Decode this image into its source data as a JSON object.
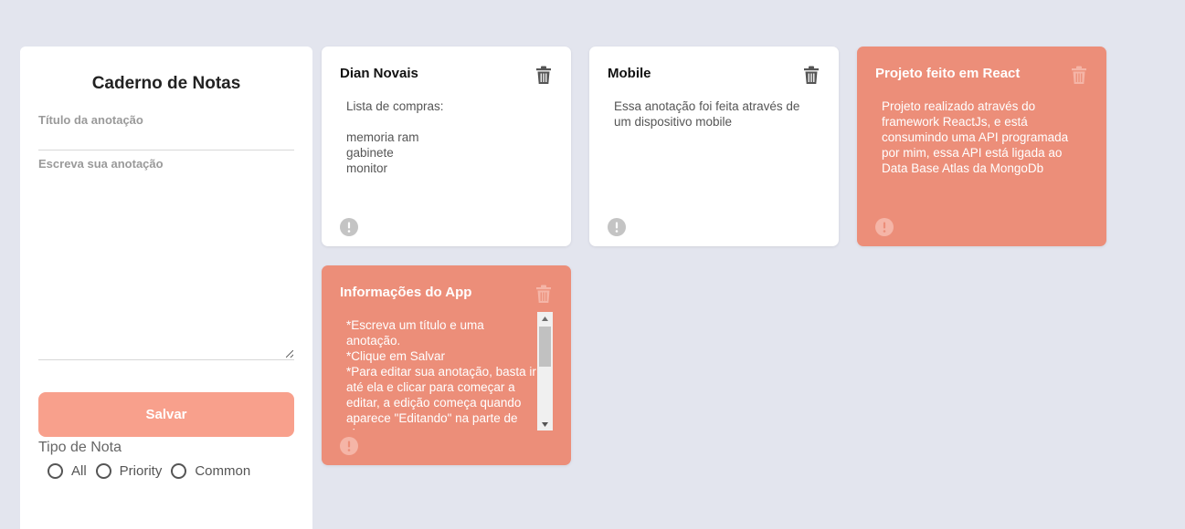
{
  "form": {
    "title": "Caderno de Notas",
    "title_placeholder": "Título da anotação",
    "note_placeholder": "Escreva sua anotação",
    "save_label": "Salvar",
    "filter_label": "Tipo de Nota",
    "filter_options": [
      "All",
      "Priority",
      "Common"
    ]
  },
  "notes": [
    {
      "title": "Dian Novais",
      "body": "Lista de compras:\n\nmemoria ram\ngabinete\nmonitor",
      "priority": false
    },
    {
      "title": "Mobile",
      "body": "Essa anotação foi feita através de um dispositivo mobile",
      "priority": false
    },
    {
      "title": "Projeto feito em React",
      "body": "Projeto realizado através do framework ReactJs, e está consumindo uma API programada por mim, essa API está ligada ao Data Base Atlas da MongoDb",
      "priority": true
    },
    {
      "title": "Informações do App",
      "body": "*Escreva um título e uma anotação.\n*Clique em Salvar\n*Para editar sua anotação, basta ir até ela e clicar para começar a editar, a edição começa quando aparece \"Editando\" na parte de cima",
      "priority": true
    }
  ],
  "colors": {
    "background": "#e3e5ee",
    "priority_card": "#ec8e79",
    "save_button": "#f8a08c",
    "white_card_icon": "#555555",
    "priority_card_icon": "#f5b5a7"
  },
  "icons": {
    "delete": "trash-icon",
    "priority": "alert-icon"
  }
}
